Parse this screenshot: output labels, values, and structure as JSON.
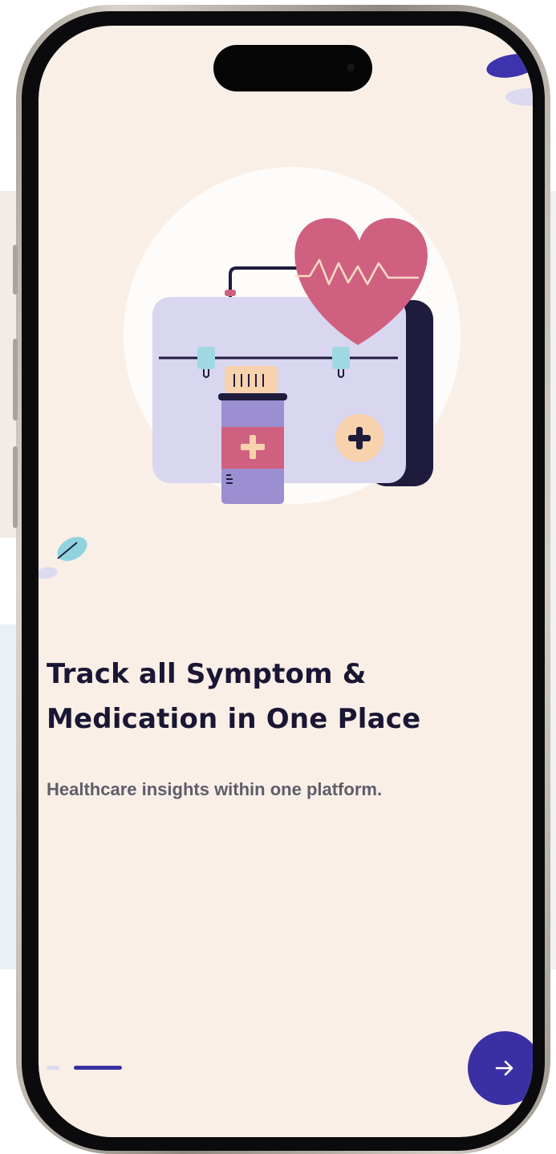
{
  "onboarding": {
    "title_line1": "Track all Symptom &",
    "title_line2": "Medication in One Place",
    "subtitle": "Healthcare insights within one platform.",
    "page_indicator": {
      "total": 2,
      "active": 2
    },
    "next_button_icon": "arrow-right-icon"
  },
  "colors": {
    "screen_background": "#f9efe7",
    "accent": "#3a30a3",
    "heading": "#1a1633",
    "body_text": "#5e5d6a",
    "heart": "#d0607f",
    "kit": "#d9d6f0"
  }
}
